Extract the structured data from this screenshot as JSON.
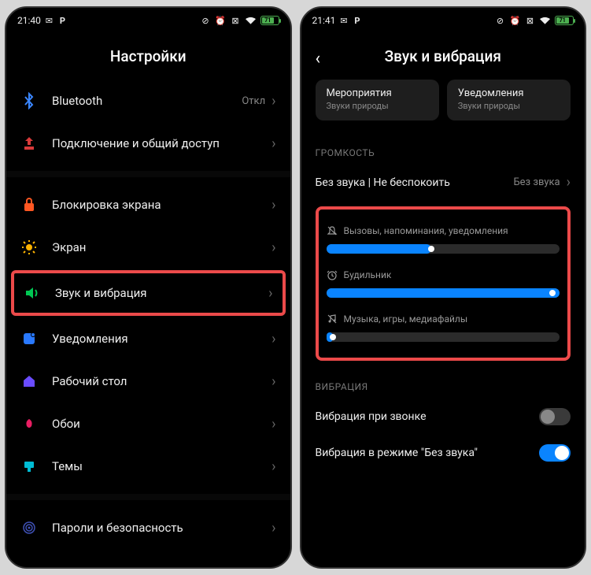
{
  "left": {
    "time": "21:40",
    "battery": "71",
    "title": "Настройки",
    "items": [
      {
        "icon": "bluetooth",
        "color": "#3a86ff",
        "label": "Bluetooth",
        "value": "Откл"
      },
      {
        "icon": "share",
        "color": "#d93a3a",
        "label": "Подключение и общий доступ"
      }
    ],
    "items2": [
      {
        "icon": "lock",
        "color": "#ff5722",
        "label": "Блокировка экрана"
      },
      {
        "icon": "sun",
        "color": "#ffb300",
        "label": "Экран"
      },
      {
        "icon": "sound",
        "color": "#00c853",
        "label": "Звук и вибрация",
        "highlighted": true
      },
      {
        "icon": "notif",
        "color": "#2979ff",
        "label": "Уведомления"
      },
      {
        "icon": "home",
        "color": "#6a4cff",
        "label": "Рабочий стол"
      },
      {
        "icon": "wall",
        "color": "#e91e63",
        "label": "Обои"
      },
      {
        "icon": "theme",
        "color": "#00bcd4",
        "label": "Темы"
      }
    ],
    "items3": [
      {
        "icon": "finger",
        "color": "#3f51b5",
        "label": "Пароли и безопасность"
      }
    ]
  },
  "right": {
    "time": "21:41",
    "battery": "71",
    "title": "Звук и вибрация",
    "profiles": [
      {
        "name": "Мероприятия",
        "sub": "Звуки природы"
      },
      {
        "name": "Уведомления",
        "sub": "Звуки природы"
      }
    ],
    "vol_section": "ГРОМКОСТЬ",
    "silent_row": {
      "label": "Без звука | Не беспокоить",
      "value": "Без звука"
    },
    "sliders": [
      {
        "icon": "bell",
        "label": "Вызовы, напоминания, уведомления",
        "pct": 45
      },
      {
        "icon": "alarm",
        "label": "Будильник",
        "pct": 100
      },
      {
        "icon": "media",
        "label": "Музыка, игры, медиафайлы",
        "pct": 3
      }
    ],
    "vib_section": "ВИБРАЦИЯ",
    "toggles": [
      {
        "label": "Вибрация при звонке",
        "on": false
      },
      {
        "label": "Вибрация в режиме \"Без звука\"",
        "on": true
      }
    ]
  }
}
